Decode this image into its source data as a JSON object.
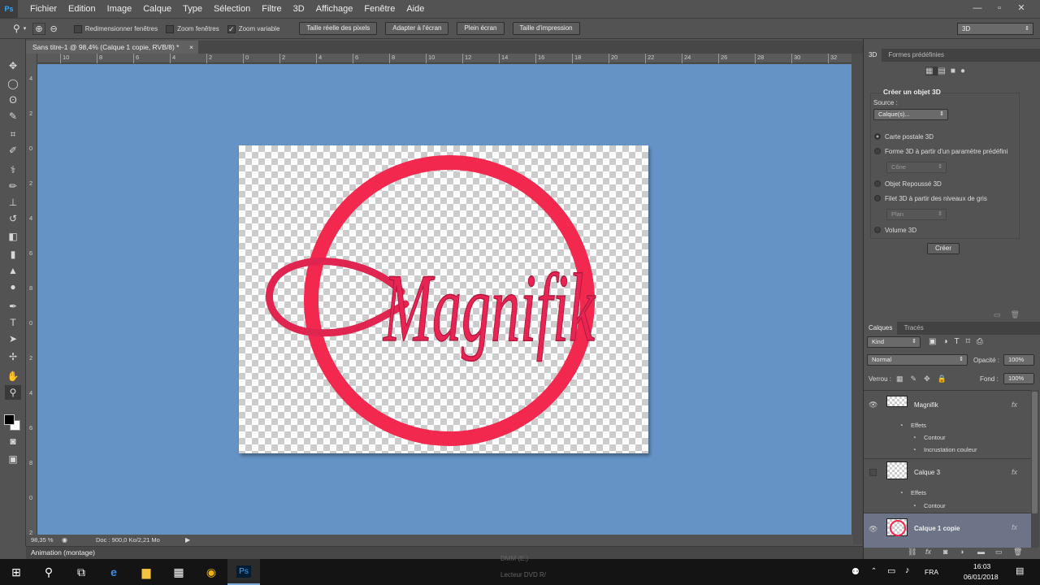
{
  "app": {
    "logo": "Ps"
  },
  "menu": [
    "Fichier",
    "Edition",
    "Image",
    "Calque",
    "Type",
    "Sélection",
    "Filtre",
    "3D",
    "Affichage",
    "Fenêtre",
    "Aide"
  ],
  "window_controls": [
    "—",
    "▫",
    "✕"
  ],
  "options": {
    "redim": "Redimensionner fenêtres",
    "zoom_all": "Zoom fenêtres",
    "zoom_var": "Zoom variable",
    "btn_actual": "Taille réelle des pixels",
    "btn_fit": "Adapter à l'écran",
    "btn_full": "Plein écran",
    "btn_print": "Taille d'impression",
    "workspace": "3D"
  },
  "document": {
    "tab_title": "Sans titre-1 @ 98,4% (Calque 1 copie, RVB/8) *",
    "close": "×",
    "logo_text": "Magnifik",
    "accent": "#f2284f",
    "canvas_bg": "#6593c5"
  },
  "rulers": {
    "top": [
      "10",
      "8",
      "6",
      "4",
      "2",
      "0",
      "2",
      "4",
      "6",
      "8",
      "10",
      "12",
      "14",
      "16",
      "18",
      "20",
      "22",
      "24",
      "26",
      "28",
      "30",
      "32"
    ],
    "left": [
      "4",
      "2",
      "0",
      "2",
      "4",
      "6",
      "8",
      "0",
      "2",
      "4",
      "6",
      "8",
      "0",
      "2"
    ]
  },
  "status": {
    "zoom": "98,35 %",
    "doc": "Doc : 900,0 Ko/2,21 Mo"
  },
  "animation_label": "Animation (montage)",
  "panel3d": {
    "tabs": [
      "3D",
      "Formes prédéfinies"
    ],
    "title": "Créer un objet 3D",
    "source_label": "Source :",
    "source_value": "Calque(s)...",
    "options": [
      "Carte postale 3D",
      "Forme 3D à partir d'un paramètre prédéfini",
      "Objet Repoussé 3D",
      "Filet 3D à partir des niveaux de gris",
      "Volume 3D"
    ],
    "shape_value": "Cône",
    "plane_value": "Plan",
    "create_button": "Créer"
  },
  "layers": {
    "tabs": [
      "Calques",
      "Tracés"
    ],
    "kind": "Kind",
    "blend_mode": "Normal",
    "opacity_label": "Opacité :",
    "opacity_value": "100%",
    "lock_label": "Verrou :",
    "fill_label": "Fond :",
    "fill_value": "100%",
    "items": [
      {
        "name": "Magnifik",
        "effects_label": "Effets",
        "effects": [
          "Contour",
          "Incrustation couleur"
        ]
      },
      {
        "name": "Calque 3",
        "effects_label": "Effets",
        "effects": [
          "Contour"
        ]
      },
      {
        "name": "Calque 1 copie",
        "effects_label": "",
        "effects": []
      }
    ],
    "fx_symbol": "fx"
  },
  "taskbar": {
    "lang": "FRA",
    "time": "16:03",
    "date": "06/01/2018",
    "bg_text_1": "Lecteur DVD R/",
    "bg_text_2": "DMM (E:)"
  }
}
